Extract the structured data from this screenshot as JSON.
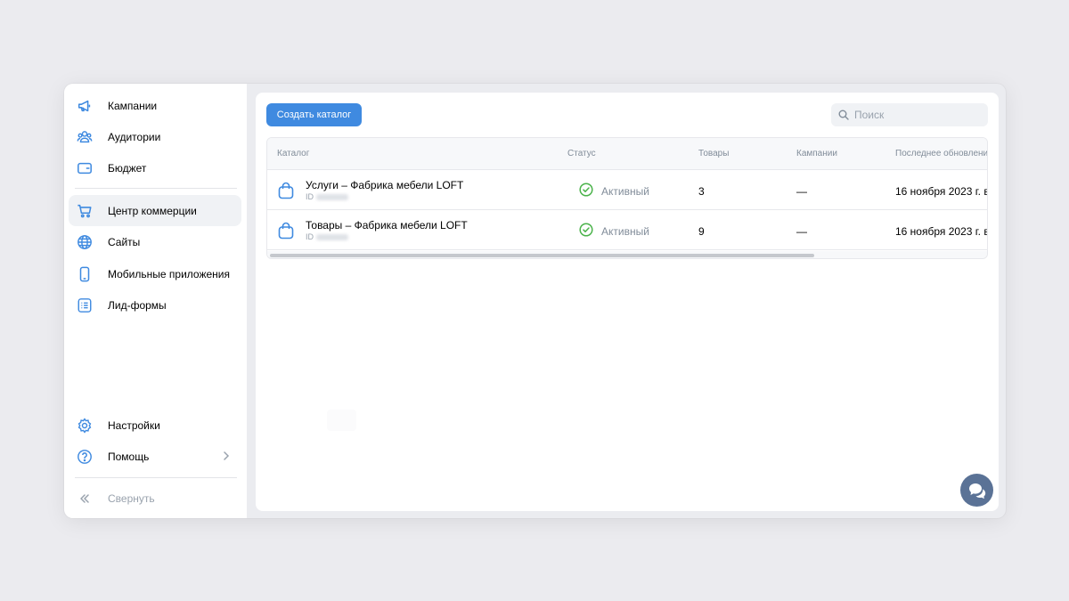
{
  "sidebar": {
    "items": [
      {
        "label": "Кампании",
        "icon": "megaphone-icon"
      },
      {
        "label": "Аудитории",
        "icon": "users-icon"
      },
      {
        "label": "Бюджет",
        "icon": "wallet-icon"
      },
      {
        "label": "Центр коммерции",
        "icon": "cart-icon",
        "active": true
      },
      {
        "label": "Сайты",
        "icon": "globe-icon"
      },
      {
        "label": "Мобильные приложения",
        "icon": "smartphone-icon"
      },
      {
        "label": "Лид-формы",
        "icon": "list-form-icon"
      }
    ],
    "bottom_items": [
      {
        "label": "Настройки",
        "icon": "gear-icon"
      },
      {
        "label": "Помощь",
        "icon": "help-icon"
      }
    ],
    "collapse_label": "Свернуть"
  },
  "toolbar": {
    "create_label": "Создать каталог",
    "search_placeholder": "Поиск"
  },
  "table": {
    "columns": [
      "Каталог",
      "Статус",
      "Товары",
      "Кампании",
      "Последнее обновлени"
    ],
    "rows": [
      {
        "name": "Услуги – Фабрика мебели LOFT",
        "id_prefix": "ID",
        "status": "Активный",
        "goods": "3",
        "campaigns": "—",
        "updated": "16 ноября 2023 г. в"
      },
      {
        "name": "Товары – Фабрика мебели LOFT",
        "id_prefix": "ID",
        "status": "Активный",
        "goods": "9",
        "campaigns": "—",
        "updated": "16 ноября 2023 г. в"
      }
    ]
  },
  "colors": {
    "accent": "#3f8ae0",
    "icon": "#3f8ae0",
    "success": "#4bb34b",
    "chat_button": "#5a7296"
  }
}
